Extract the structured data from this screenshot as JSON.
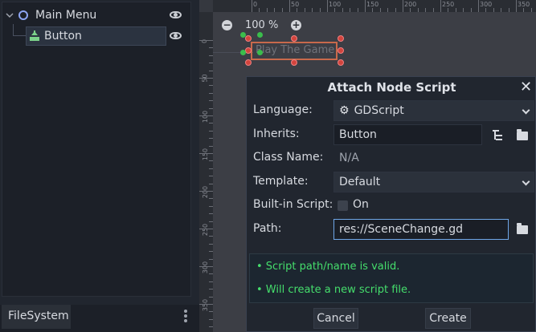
{
  "scene_dock": {
    "items": [
      {
        "label": "Main Menu",
        "icon": "control-node-icon"
      },
      {
        "label": "Button",
        "icon": "button-node-icon"
      }
    ],
    "filesystem_tab": "FileSystem"
  },
  "viewport": {
    "zoom": "100 %",
    "ruler_top": [
      "0",
      "50",
      "100",
      "150",
      "200",
      "250",
      "300",
      "350"
    ],
    "ruler_left": [
      "0",
      "50",
      "100",
      "150",
      "200",
      "250",
      "300",
      "350"
    ],
    "canvas_button_text": "Play The Game"
  },
  "dialog": {
    "title": "Attach Node Script",
    "language_label": "Language:",
    "language_value": "GDScript",
    "inherits_label": "Inherits:",
    "inherits_value": "Button",
    "classname_label": "Class Name:",
    "classname_value": "N/A",
    "template_label": "Template:",
    "template_value": "Default",
    "builtin_label": "Built-in Script:",
    "builtin_value": "On",
    "path_label": "Path:",
    "path_value": "res://SceneChange.gd",
    "messages": [
      "• Script path/name is valid.",
      "• Will create a new script file."
    ],
    "cancel": "Cancel",
    "create": "Create"
  },
  "colors": {
    "accent": "#6fa7e8",
    "valid_message": "#45de6c",
    "selection_handle": "#d2443d",
    "selection_border": "#c8694b"
  }
}
